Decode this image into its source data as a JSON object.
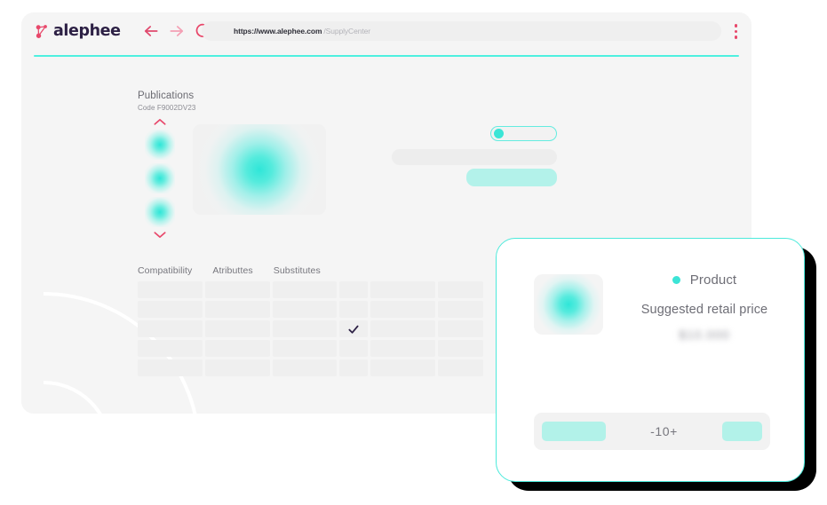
{
  "browser": {
    "brand": "alephee",
    "logo_icon": "molecule-icon",
    "back_icon": "arrow-left-icon",
    "forward_icon": "arrow-right-icon",
    "reload_icon": "refresh-icon",
    "menu_icon": "kebab-menu-icon",
    "url_domain": "https://www.alephee.com",
    "url_path": "/SupplyCenter"
  },
  "page": {
    "section_title": "Publications",
    "section_code": "Code F9002DV23",
    "thumb_up_icon": "chevron-up-icon",
    "thumb_down_icon": "chevron-down-icon",
    "thumbnails": [
      "thumb-1",
      "thumb-2",
      "thumb-3"
    ],
    "hero_image": "product-hero-image",
    "toggle_state": "on",
    "table": {
      "headers": [
        "Compatibility",
        "Atributtes",
        "Substitutes"
      ],
      "rows": [
        {
          "cells": [
            "",
            "",
            "",
            "",
            "",
            ""
          ],
          "check": false
        },
        {
          "cells": [
            "",
            "",
            "",
            "",
            "",
            ""
          ],
          "check": false
        },
        {
          "cells": [
            "",
            "",
            "",
            "",
            "",
            ""
          ],
          "check": true
        },
        {
          "cells": [
            "",
            "",
            "",
            "",
            "",
            ""
          ],
          "check": false
        },
        {
          "cells": [
            "",
            "",
            "",
            "",
            "",
            ""
          ],
          "check": false
        }
      ],
      "check_icon": "check-icon"
    }
  },
  "product_card": {
    "thumb": "product-card-image",
    "status_dot": "status-dot-cyan",
    "product_label": "Product",
    "price_label": "Suggested retail price",
    "price_value": "$10.000",
    "stepper_value": "-10+"
  },
  "colors": {
    "accent_cyan": "#4ceadb",
    "accent_pink": "#e8486b",
    "logo_navy": "#2d2145",
    "surface": "#f5f5f5"
  }
}
